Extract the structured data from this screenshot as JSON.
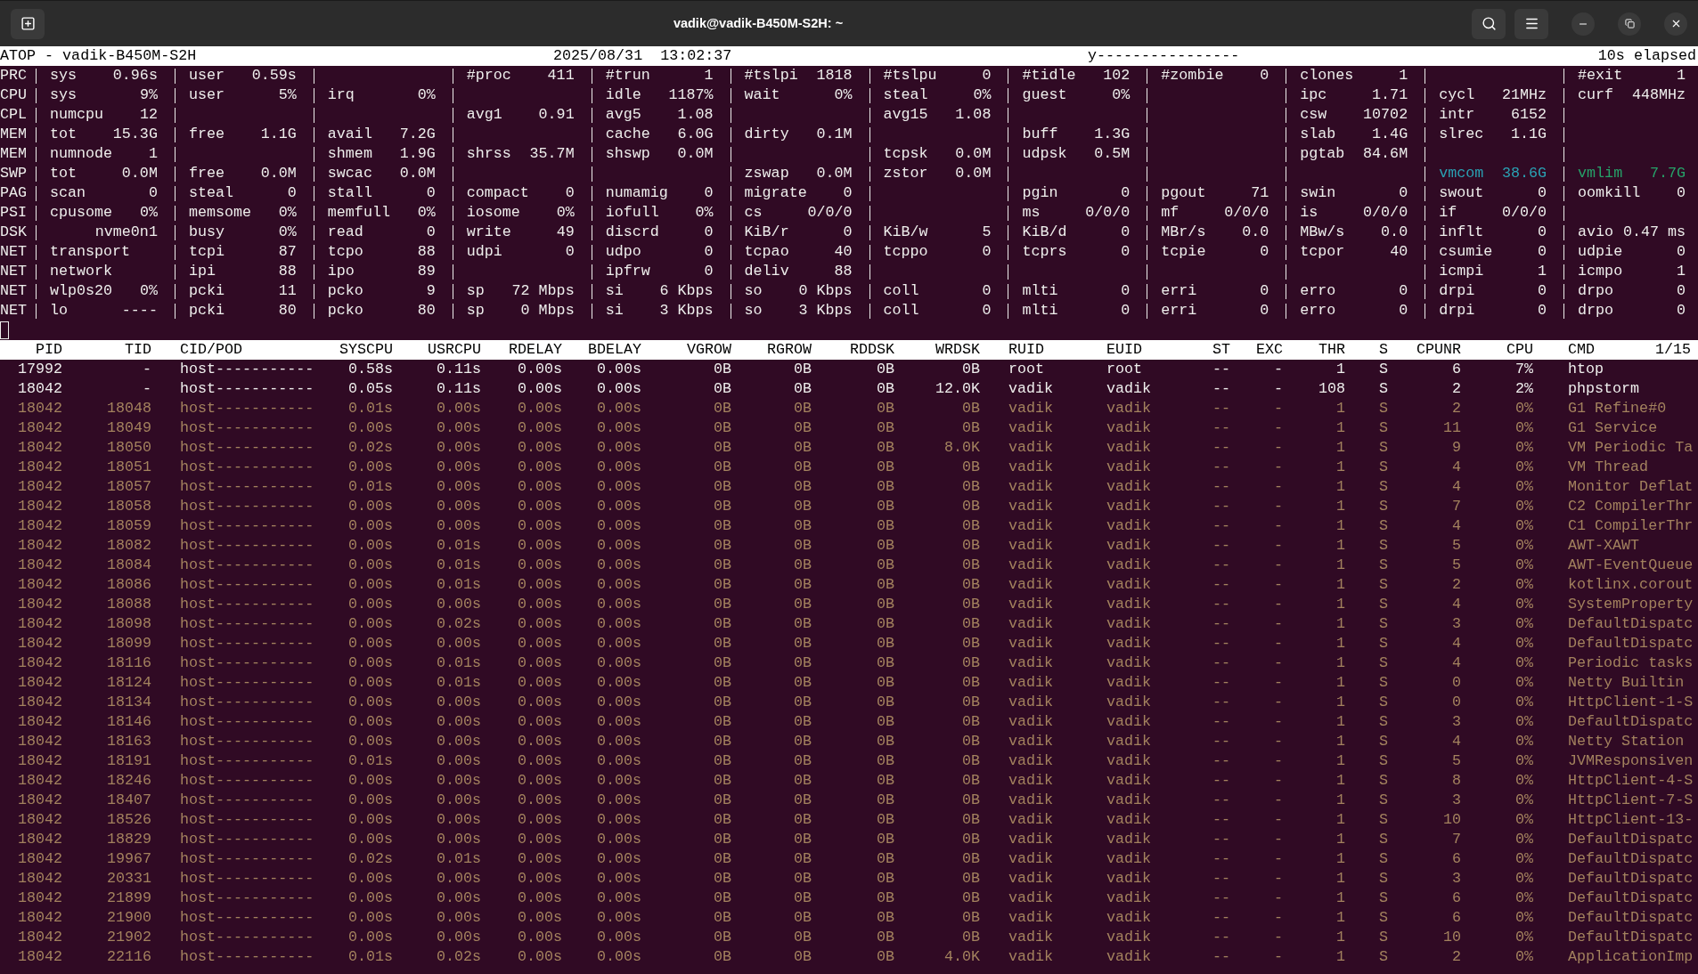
{
  "window": {
    "title": "vadik@vadik-B450M-S2H: ~"
  },
  "status": {
    "title": "ATOP - vadik-B450M-S2H",
    "date": "2025/08/31",
    "time": "13:02:37",
    "mode": "y----------------",
    "elapsed": "10s elapsed"
  },
  "system_rows": [
    {
      "label": "PRC",
      "fields": [
        {
          "name": "sys",
          "value": "0.96s"
        },
        {
          "name": "user",
          "value": "0.59s"
        },
        {
          "kind": "gap"
        },
        {
          "name": "#proc",
          "value": "411"
        },
        {
          "name": "#trun",
          "value": "1"
        },
        {
          "name": "#tslpi",
          "value": "1818"
        },
        {
          "name": "#tslpu",
          "value": "0"
        },
        {
          "name": "#tidle",
          "value": "102"
        },
        {
          "name": "#zombie",
          "value": "0"
        },
        {
          "name": "clones",
          "value": "1"
        },
        {
          "kind": "gap"
        },
        {
          "name": "#exit",
          "value": "1"
        }
      ]
    },
    {
      "label": "CPU",
      "fields": [
        {
          "name": "sys",
          "value": "9%"
        },
        {
          "name": "user",
          "value": "5%"
        },
        {
          "name": "irq",
          "value": "0%"
        },
        {
          "kind": "gap"
        },
        {
          "name": "idle",
          "value": "1187%"
        },
        {
          "name": "wait",
          "value": "0%"
        },
        {
          "name": "steal",
          "value": "0%"
        },
        {
          "name": "guest",
          "value": "0%"
        },
        {
          "kind": "gap"
        },
        {
          "name": "ipc",
          "value": "1.71"
        },
        {
          "name": "cycl",
          "value": "21MHz"
        },
        {
          "name": "curf",
          "value": "448MHz"
        }
      ]
    },
    {
      "label": "CPL",
      "fields": [
        {
          "name": "numcpu",
          "value": "12"
        },
        {
          "kind": "gap"
        },
        {
          "kind": "gap"
        },
        {
          "name": "avg1",
          "value": "0.91"
        },
        {
          "name": "avg5",
          "value": "1.08"
        },
        {
          "kind": "gap"
        },
        {
          "name": "avg15",
          "value": "1.08"
        },
        {
          "kind": "gap"
        },
        {
          "kind": "gap"
        },
        {
          "name": "csw",
          "value": "10702"
        },
        {
          "name": "intr",
          "value": "6152"
        },
        {
          "kind": "gap"
        }
      ]
    },
    {
      "label": "MEM",
      "fields": [
        {
          "name": "tot",
          "value": "15.3G"
        },
        {
          "name": "free",
          "value": "1.1G"
        },
        {
          "name": "avail",
          "value": "7.2G"
        },
        {
          "kind": "gap"
        },
        {
          "name": "cache",
          "value": "6.0G"
        },
        {
          "name": "dirty",
          "value": "0.1M"
        },
        {
          "kind": "gap"
        },
        {
          "name": "buff",
          "value": "1.3G"
        },
        {
          "kind": "gap"
        },
        {
          "name": "slab",
          "value": "1.4G"
        },
        {
          "name": "slrec",
          "value": "1.1G"
        },
        {
          "kind": "gap"
        }
      ]
    },
    {
      "label": "MEM",
      "fields": [
        {
          "name": "numnode",
          "value": "1"
        },
        {
          "kind": "gap"
        },
        {
          "name": "shmem",
          "value": "1.9G"
        },
        {
          "name": "shrss",
          "value": "35.7M"
        },
        {
          "name": "shswp",
          "value": "0.0M"
        },
        {
          "kind": "gap"
        },
        {
          "name": "tcpsk",
          "value": "0.0M"
        },
        {
          "name": "udpsk",
          "value": "0.5M"
        },
        {
          "kind": "gap"
        },
        {
          "name": "pgtab",
          "value": "84.6M"
        },
        {
          "kind": "gap"
        },
        {
          "kind": "gap"
        }
      ]
    },
    {
      "label": "SWP",
      "fields": [
        {
          "name": "tot",
          "value": "0.0M"
        },
        {
          "name": "free",
          "value": "0.0M"
        },
        {
          "name": "swcac",
          "value": "0.0M"
        },
        {
          "kind": "gap"
        },
        {
          "kind": "gap"
        },
        {
          "name": "zswap",
          "value": "0.0M"
        },
        {
          "name": "zstor",
          "value": "0.0M"
        },
        {
          "kind": "gap"
        },
        {
          "kind": "gap"
        },
        {
          "kind": "gap"
        },
        {
          "name": "vmcom",
          "value": "38.6G",
          "color": "#2aa1b3"
        },
        {
          "name": "vmlim",
          "value": "7.7G",
          "color": "#26a269"
        }
      ]
    },
    {
      "label": "PAG",
      "fields": [
        {
          "name": "scan",
          "value": "0"
        },
        {
          "name": "steal",
          "value": "0"
        },
        {
          "name": "stall",
          "value": "0"
        },
        {
          "name": "compact",
          "value": "0"
        },
        {
          "name": "numamig",
          "value": "0"
        },
        {
          "name": "migrate",
          "value": "0"
        },
        {
          "kind": "gap"
        },
        {
          "name": "pgin",
          "value": "0"
        },
        {
          "name": "pgout",
          "value": "71"
        },
        {
          "name": "swin",
          "value": "0"
        },
        {
          "name": "swout",
          "value": "0"
        },
        {
          "name": "oomkill",
          "value": "0"
        }
      ]
    },
    {
      "label": "PSI",
      "fields": [
        {
          "name": "cpusome",
          "value": "0%"
        },
        {
          "name": "memsome",
          "value": "0%"
        },
        {
          "name": "memfull",
          "value": "0%"
        },
        {
          "name": "iosome",
          "value": "0%"
        },
        {
          "name": "iofull",
          "value": "0%"
        },
        {
          "name": "cs",
          "value": "0/0/0"
        },
        {
          "kind": "gap"
        },
        {
          "name": "ms",
          "value": "0/0/0"
        },
        {
          "name": "mf",
          "value": "0/0/0"
        },
        {
          "name": "is",
          "value": "0/0/0"
        },
        {
          "name": "if",
          "value": "0/0/0"
        },
        {
          "kind": "gap"
        }
      ]
    },
    {
      "label": "DSK",
      "fields": [
        {
          "value": "nvme0n1"
        },
        {
          "name": "busy",
          "value": "0%"
        },
        {
          "name": "read",
          "value": "0"
        },
        {
          "name": "write",
          "value": "49"
        },
        {
          "name": "discrd",
          "value": "0"
        },
        {
          "name": "KiB/r",
          "value": "0"
        },
        {
          "name": "KiB/w",
          "value": "5"
        },
        {
          "name": "KiB/d",
          "value": "0"
        },
        {
          "name": "MBr/s",
          "value": "0.0"
        },
        {
          "name": "MBw/s",
          "value": "0.0"
        },
        {
          "name": "inflt",
          "value": "0"
        },
        {
          "name": "avio",
          "value": "0.47 ms"
        }
      ]
    },
    {
      "label": "NET",
      "fields": [
        {
          "name": "transport"
        },
        {
          "name": "tcpi",
          "value": "87"
        },
        {
          "name": "tcpo",
          "value": "88"
        },
        {
          "name": "udpi",
          "value": "0"
        },
        {
          "name": "udpo",
          "value": "0"
        },
        {
          "name": "tcpao",
          "value": "40"
        },
        {
          "name": "tcppo",
          "value": "0"
        },
        {
          "name": "tcprs",
          "value": "0"
        },
        {
          "name": "tcpie",
          "value": "0"
        },
        {
          "name": "tcpor",
          "value": "40"
        },
        {
          "name": "csumie",
          "value": "0"
        },
        {
          "name": "udpie",
          "value": "0"
        }
      ]
    },
    {
      "label": "NET",
      "fields": [
        {
          "name": "network"
        },
        {
          "name": "ipi",
          "value": "88"
        },
        {
          "name": "ipo",
          "value": "89"
        },
        {
          "kind": "gap"
        },
        {
          "name": "ipfrw",
          "value": "0"
        },
        {
          "name": "deliv",
          "value": "88"
        },
        {
          "kind": "gap"
        },
        {
          "kind": "gap"
        },
        {
          "kind": "gap"
        },
        {
          "kind": "gap"
        },
        {
          "name": "icmpi",
          "value": "1"
        },
        {
          "name": "icmpo",
          "value": "1"
        }
      ]
    },
    {
      "label": "NET",
      "fields": [
        {
          "name": "wlp0s20",
          "value": "0%"
        },
        {
          "name": "pcki",
          "value": "11"
        },
        {
          "name": "pcko",
          "value": "9"
        },
        {
          "name": "sp",
          "value": "72 Mbps"
        },
        {
          "name": "si",
          "value": "6 Kbps"
        },
        {
          "name": "so",
          "value": "0 Kbps"
        },
        {
          "name": "coll",
          "value": "0"
        },
        {
          "name": "mlti",
          "value": "0"
        },
        {
          "name": "erri",
          "value": "0"
        },
        {
          "name": "erro",
          "value": "0"
        },
        {
          "name": "drpi",
          "value": "0"
        },
        {
          "name": "drpo",
          "value": "0"
        }
      ]
    },
    {
      "label": "NET",
      "fields": [
        {
          "name": "lo",
          "value": "----"
        },
        {
          "name": "pcki",
          "value": "80"
        },
        {
          "name": "pcko",
          "value": "80"
        },
        {
          "name": "sp",
          "value": "0 Mbps"
        },
        {
          "name": "si",
          "value": "3 Kbps"
        },
        {
          "name": "so",
          "value": "3 Kbps"
        },
        {
          "name": "coll",
          "value": "0"
        },
        {
          "name": "mlti",
          "value": "0"
        },
        {
          "name": "erri",
          "value": "0"
        },
        {
          "name": "erro",
          "value": "0"
        },
        {
          "name": "drpi",
          "value": "0"
        },
        {
          "name": "drpo",
          "value": "0"
        }
      ]
    }
  ],
  "process_table": {
    "columns": [
      "PID",
      "TID",
      "CID/POD",
      "SYSCPU",
      "USRCPU",
      "RDELAY",
      "BDELAY",
      "VGROW",
      "RGROW",
      "RDDSK",
      "WRDSK",
      "RUID",
      "EUID",
      "ST",
      "EXC",
      "THR",
      "S",
      "CPUNR",
      "CPU",
      "CMD"
    ],
    "page": "1/15",
    "rows": [
      {
        "kind": "process",
        "cells": [
          "17992",
          "-",
          "host-----------",
          "0.58s",
          "0.11s",
          "0.00s",
          "0.00s",
          "0B",
          "0B",
          "0B",
          "0B",
          "root",
          "root",
          "--",
          "-",
          "1",
          "S",
          "6",
          "7%",
          "htop"
        ]
      },
      {
        "kind": "process",
        "cells": [
          "18042",
          "-",
          "host-----------",
          "0.05s",
          "0.11s",
          "0.00s",
          "0.00s",
          "0B",
          "0B",
          "0B",
          "12.0K",
          "vadik",
          "vadik",
          "--",
          "-",
          "108",
          "S",
          "2",
          "2%",
          "phpstorm"
        ]
      },
      {
        "kind": "thread",
        "cells": [
          "18042",
          "18048",
          "host-----------",
          "0.01s",
          "0.00s",
          "0.00s",
          "0.00s",
          "0B",
          "0B",
          "0B",
          "0B",
          "vadik",
          "vadik",
          "--",
          "-",
          "1",
          "S",
          "2",
          "0%",
          "G1 Refine#0"
        ]
      },
      {
        "kind": "thread",
        "cells": [
          "18042",
          "18049",
          "host-----------",
          "0.00s",
          "0.00s",
          "0.00s",
          "0.00s",
          "0B",
          "0B",
          "0B",
          "0B",
          "vadik",
          "vadik",
          "--",
          "-",
          "1",
          "S",
          "11",
          "0%",
          "G1 Service"
        ]
      },
      {
        "kind": "thread",
        "cells": [
          "18042",
          "18050",
          "host-----------",
          "0.02s",
          "0.00s",
          "0.00s",
          "0.00s",
          "0B",
          "0B",
          "0B",
          "8.0K",
          "vadik",
          "vadik",
          "--",
          "-",
          "1",
          "S",
          "9",
          "0%",
          "VM Periodic Ta"
        ]
      },
      {
        "kind": "thread",
        "cells": [
          "18042",
          "18051",
          "host-----------",
          "0.00s",
          "0.00s",
          "0.00s",
          "0.00s",
          "0B",
          "0B",
          "0B",
          "0B",
          "vadik",
          "vadik",
          "--",
          "-",
          "1",
          "S",
          "4",
          "0%",
          "VM Thread"
        ]
      },
      {
        "kind": "thread",
        "cells": [
          "18042",
          "18057",
          "host-----------",
          "0.01s",
          "0.00s",
          "0.00s",
          "0.00s",
          "0B",
          "0B",
          "0B",
          "0B",
          "vadik",
          "vadik",
          "--",
          "-",
          "1",
          "S",
          "4",
          "0%",
          "Monitor Deflat"
        ]
      },
      {
        "kind": "thread",
        "cells": [
          "18042",
          "18058",
          "host-----------",
          "0.00s",
          "0.00s",
          "0.00s",
          "0.00s",
          "0B",
          "0B",
          "0B",
          "0B",
          "vadik",
          "vadik",
          "--",
          "-",
          "1",
          "S",
          "7",
          "0%",
          "C2 CompilerThr"
        ]
      },
      {
        "kind": "thread",
        "cells": [
          "18042",
          "18059",
          "host-----------",
          "0.00s",
          "0.00s",
          "0.00s",
          "0.00s",
          "0B",
          "0B",
          "0B",
          "0B",
          "vadik",
          "vadik",
          "--",
          "-",
          "1",
          "S",
          "4",
          "0%",
          "C1 CompilerThr"
        ]
      },
      {
        "kind": "thread",
        "cells": [
          "18042",
          "18082",
          "host-----------",
          "0.00s",
          "0.01s",
          "0.00s",
          "0.00s",
          "0B",
          "0B",
          "0B",
          "0B",
          "vadik",
          "vadik",
          "--",
          "-",
          "1",
          "S",
          "5",
          "0%",
          "AWT-XAWT"
        ]
      },
      {
        "kind": "thread",
        "cells": [
          "18042",
          "18084",
          "host-----------",
          "0.00s",
          "0.01s",
          "0.00s",
          "0.00s",
          "0B",
          "0B",
          "0B",
          "0B",
          "vadik",
          "vadik",
          "--",
          "-",
          "1",
          "S",
          "5",
          "0%",
          "AWT-EventQueue"
        ]
      },
      {
        "kind": "thread",
        "cells": [
          "18042",
          "18086",
          "host-----------",
          "0.00s",
          "0.01s",
          "0.00s",
          "0.00s",
          "0B",
          "0B",
          "0B",
          "0B",
          "vadik",
          "vadik",
          "--",
          "-",
          "1",
          "S",
          "2",
          "0%",
          "kotlinx.corout"
        ]
      },
      {
        "kind": "thread",
        "cells": [
          "18042",
          "18088",
          "host-----------",
          "0.00s",
          "0.00s",
          "0.00s",
          "0.00s",
          "0B",
          "0B",
          "0B",
          "0B",
          "vadik",
          "vadik",
          "--",
          "-",
          "1",
          "S",
          "4",
          "0%",
          "SystemProperty"
        ]
      },
      {
        "kind": "thread",
        "cells": [
          "18042",
          "18098",
          "host-----------",
          "0.00s",
          "0.02s",
          "0.00s",
          "0.00s",
          "0B",
          "0B",
          "0B",
          "0B",
          "vadik",
          "vadik",
          "--",
          "-",
          "1",
          "S",
          "3",
          "0%",
          "DefaultDispatc"
        ]
      },
      {
        "kind": "thread",
        "cells": [
          "18042",
          "18099",
          "host-----------",
          "0.00s",
          "0.00s",
          "0.00s",
          "0.00s",
          "0B",
          "0B",
          "0B",
          "0B",
          "vadik",
          "vadik",
          "--",
          "-",
          "1",
          "S",
          "4",
          "0%",
          "DefaultDispatc"
        ]
      },
      {
        "kind": "thread",
        "cells": [
          "18042",
          "18116",
          "host-----------",
          "0.00s",
          "0.01s",
          "0.00s",
          "0.00s",
          "0B",
          "0B",
          "0B",
          "0B",
          "vadik",
          "vadik",
          "--",
          "-",
          "1",
          "S",
          "4",
          "0%",
          "Periodic tasks"
        ]
      },
      {
        "kind": "thread",
        "cells": [
          "18042",
          "18124",
          "host-----------",
          "0.00s",
          "0.01s",
          "0.00s",
          "0.00s",
          "0B",
          "0B",
          "0B",
          "0B",
          "vadik",
          "vadik",
          "--",
          "-",
          "1",
          "S",
          "0",
          "0%",
          "Netty Builtin"
        ]
      },
      {
        "kind": "thread",
        "cells": [
          "18042",
          "18134",
          "host-----------",
          "0.00s",
          "0.00s",
          "0.00s",
          "0.00s",
          "0B",
          "0B",
          "0B",
          "0B",
          "vadik",
          "vadik",
          "--",
          "-",
          "1",
          "S",
          "0",
          "0%",
          "HttpClient-1-S"
        ]
      },
      {
        "kind": "thread",
        "cells": [
          "18042",
          "18146",
          "host-----------",
          "0.00s",
          "0.00s",
          "0.00s",
          "0.00s",
          "0B",
          "0B",
          "0B",
          "0B",
          "vadik",
          "vadik",
          "--",
          "-",
          "1",
          "S",
          "3",
          "0%",
          "DefaultDispatc"
        ]
      },
      {
        "kind": "thread",
        "cells": [
          "18042",
          "18163",
          "host-----------",
          "0.00s",
          "0.00s",
          "0.00s",
          "0.00s",
          "0B",
          "0B",
          "0B",
          "0B",
          "vadik",
          "vadik",
          "--",
          "-",
          "1",
          "S",
          "4",
          "0%",
          "Netty Station"
        ]
      },
      {
        "kind": "thread",
        "cells": [
          "18042",
          "18191",
          "host-----------",
          "0.01s",
          "0.00s",
          "0.00s",
          "0.00s",
          "0B",
          "0B",
          "0B",
          "0B",
          "vadik",
          "vadik",
          "--",
          "-",
          "1",
          "S",
          "5",
          "0%",
          "JVMResponsiven"
        ]
      },
      {
        "kind": "thread",
        "cells": [
          "18042",
          "18246",
          "host-----------",
          "0.00s",
          "0.00s",
          "0.00s",
          "0.00s",
          "0B",
          "0B",
          "0B",
          "0B",
          "vadik",
          "vadik",
          "--",
          "-",
          "1",
          "S",
          "8",
          "0%",
          "HttpClient-4-S"
        ]
      },
      {
        "kind": "thread",
        "cells": [
          "18042",
          "18407",
          "host-----------",
          "0.00s",
          "0.00s",
          "0.00s",
          "0.00s",
          "0B",
          "0B",
          "0B",
          "0B",
          "vadik",
          "vadik",
          "--",
          "-",
          "1",
          "S",
          "3",
          "0%",
          "HttpClient-7-S"
        ]
      },
      {
        "kind": "thread",
        "cells": [
          "18042",
          "18526",
          "host-----------",
          "0.00s",
          "0.00s",
          "0.00s",
          "0.00s",
          "0B",
          "0B",
          "0B",
          "0B",
          "vadik",
          "vadik",
          "--",
          "-",
          "1",
          "S",
          "10",
          "0%",
          "HttpClient-13-"
        ]
      },
      {
        "kind": "thread",
        "cells": [
          "18042",
          "18829",
          "host-----------",
          "0.00s",
          "0.00s",
          "0.00s",
          "0.00s",
          "0B",
          "0B",
          "0B",
          "0B",
          "vadik",
          "vadik",
          "--",
          "-",
          "1",
          "S",
          "7",
          "0%",
          "DefaultDispatc"
        ]
      },
      {
        "kind": "thread",
        "cells": [
          "18042",
          "19967",
          "host-----------",
          "0.02s",
          "0.01s",
          "0.00s",
          "0.00s",
          "0B",
          "0B",
          "0B",
          "0B",
          "vadik",
          "vadik",
          "--",
          "-",
          "1",
          "S",
          "6",
          "0%",
          "DefaultDispatc"
        ]
      },
      {
        "kind": "thread",
        "cells": [
          "18042",
          "20331",
          "host-----------",
          "0.00s",
          "0.00s",
          "0.00s",
          "0.00s",
          "0B",
          "0B",
          "0B",
          "0B",
          "vadik",
          "vadik",
          "--",
          "-",
          "1",
          "S",
          "3",
          "0%",
          "DefaultDispatc"
        ]
      },
      {
        "kind": "thread",
        "cells": [
          "18042",
          "21899",
          "host-----------",
          "0.00s",
          "0.00s",
          "0.00s",
          "0.00s",
          "0B",
          "0B",
          "0B",
          "0B",
          "vadik",
          "vadik",
          "--",
          "-",
          "1",
          "S",
          "6",
          "0%",
          "DefaultDispatc"
        ]
      },
      {
        "kind": "thread",
        "cells": [
          "18042",
          "21900",
          "host-----------",
          "0.00s",
          "0.00s",
          "0.00s",
          "0.00s",
          "0B",
          "0B",
          "0B",
          "0B",
          "vadik",
          "vadik",
          "--",
          "-",
          "1",
          "S",
          "6",
          "0%",
          "DefaultDispatc"
        ]
      },
      {
        "kind": "thread",
        "cells": [
          "18042",
          "21902",
          "host-----------",
          "0.00s",
          "0.00s",
          "0.00s",
          "0.00s",
          "0B",
          "0B",
          "0B",
          "0B",
          "vadik",
          "vadik",
          "--",
          "-",
          "1",
          "S",
          "10",
          "0%",
          "DefaultDispatc"
        ]
      },
      {
        "kind": "thread",
        "cells": [
          "18042",
          "22116",
          "host-----------",
          "0.01s",
          "0.02s",
          "0.00s",
          "0.00s",
          "0B",
          "0B",
          "0B",
          "4.0K",
          "vadik",
          "vadik",
          "--",
          "-",
          "1",
          "S",
          "2",
          "0%",
          "ApplicationImp"
        ]
      }
    ]
  }
}
